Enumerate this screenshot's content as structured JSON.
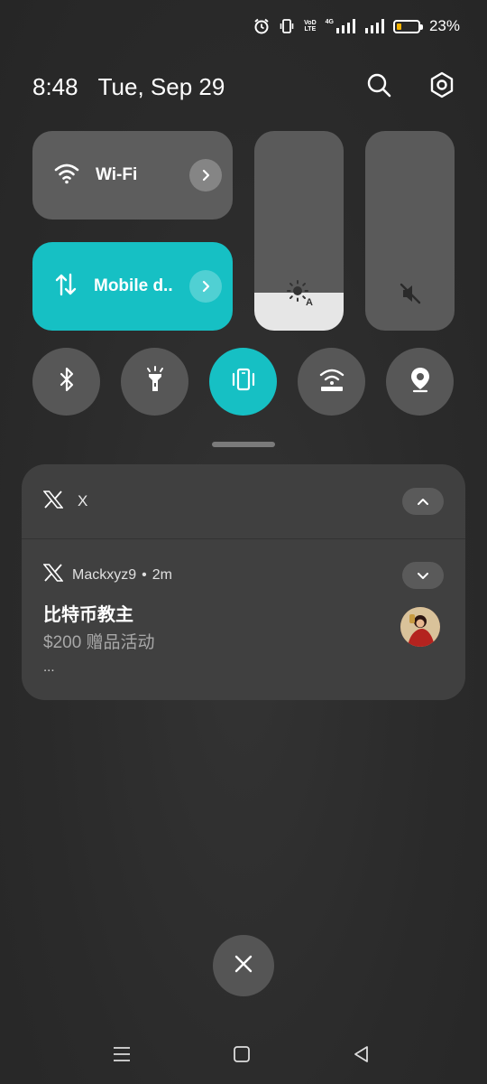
{
  "status_bar": {
    "battery_percent": "23%",
    "battery_level": 0.23,
    "vo_label_top": "VoD",
    "vo_label_bottom": "LTE",
    "net_label": "4G",
    "icons": [
      "alarm-icon",
      "vibrate-icon",
      "volte-icon",
      "signal-4g-icon",
      "signal-icon",
      "battery-icon"
    ],
    "battery_color": "#f5b400"
  },
  "header": {
    "time": "8:48",
    "date": "Tue, Sep 29",
    "icons": [
      "search-icon",
      "settings-icon"
    ]
  },
  "tiles": {
    "wifi": {
      "label": "Wi-Fi",
      "icon": "wifi-icon"
    },
    "mobile_data": {
      "label": "Mobile d..",
      "icon": "mobile-data-icon",
      "active": true
    }
  },
  "sliders": {
    "brightness": {
      "level": 0.19,
      "icon": "brightness-auto-icon"
    },
    "volume": {
      "level": 0.0,
      "icon": "volume-muted-icon"
    }
  },
  "toggles": [
    {
      "name": "bluetooth",
      "icon": "bluetooth-icon",
      "active": false
    },
    {
      "name": "flashlight",
      "icon": "flashlight-icon",
      "active": false
    },
    {
      "name": "vibrate",
      "icon": "vibrate-icon",
      "active": true
    },
    {
      "name": "hotspot",
      "icon": "hotspot-icon",
      "active": false
    },
    {
      "name": "location",
      "icon": "location-icon",
      "active": false
    }
  ],
  "notification": {
    "app_name": "X",
    "sender": "Mackxyz9",
    "separator": "•",
    "time_ago": "2m",
    "title": "比特币教主",
    "text": "$200 赠品活动",
    "more": "..."
  },
  "colors": {
    "accent": "#16c0c4",
    "tile_bg": "#5d5d5d",
    "card_bg": "#404040"
  }
}
